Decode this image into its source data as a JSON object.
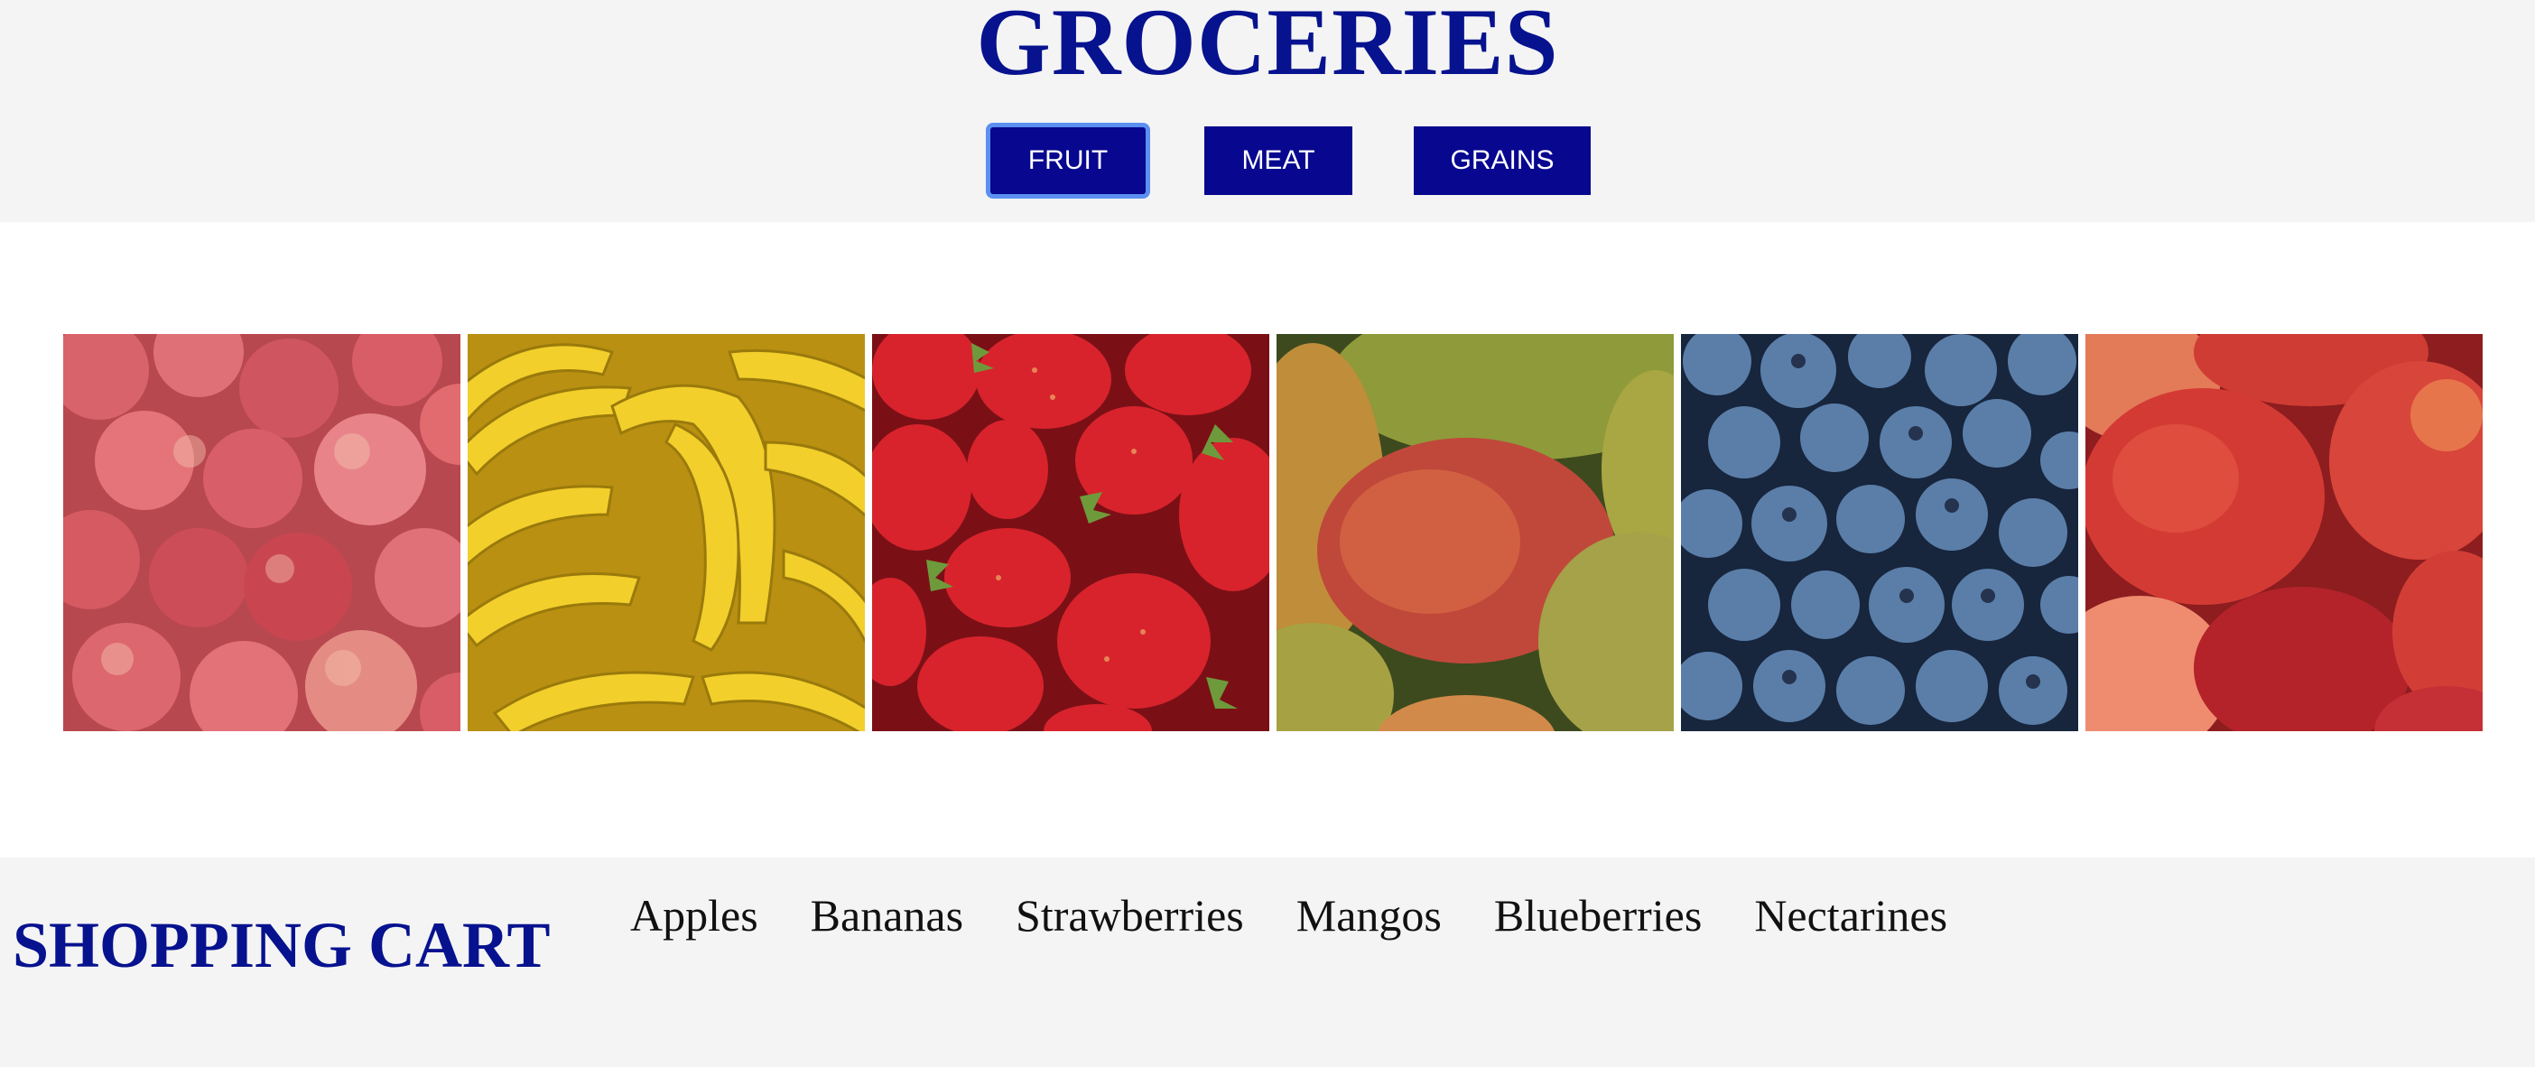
{
  "header": {
    "title": "GROCERIES",
    "nav": [
      {
        "label": "FRUIT",
        "active": true
      },
      {
        "label": "MEAT",
        "active": false
      },
      {
        "label": "GRAINS",
        "active": false
      }
    ]
  },
  "gallery": {
    "images": [
      {
        "name": "apples-image",
        "icon": "apples"
      },
      {
        "name": "bananas-image",
        "icon": "bananas"
      },
      {
        "name": "strawberries-image",
        "icon": "strawberries"
      },
      {
        "name": "mangos-image",
        "icon": "mangos"
      },
      {
        "name": "blueberries-image",
        "icon": "blueberries"
      },
      {
        "name": "nectarines-image",
        "icon": "nectarines"
      }
    ]
  },
  "cart": {
    "title": "SHOPPING CART",
    "items": [
      "Apples",
      "Bananas",
      "Strawberries",
      "Mangos",
      "Blueberries",
      "Nectarines"
    ]
  },
  "colors": {
    "brand": "#07128f",
    "button_bg": "#07078f",
    "focus_ring": "#5b8ff0",
    "band_bg": "#f4f4f4"
  }
}
